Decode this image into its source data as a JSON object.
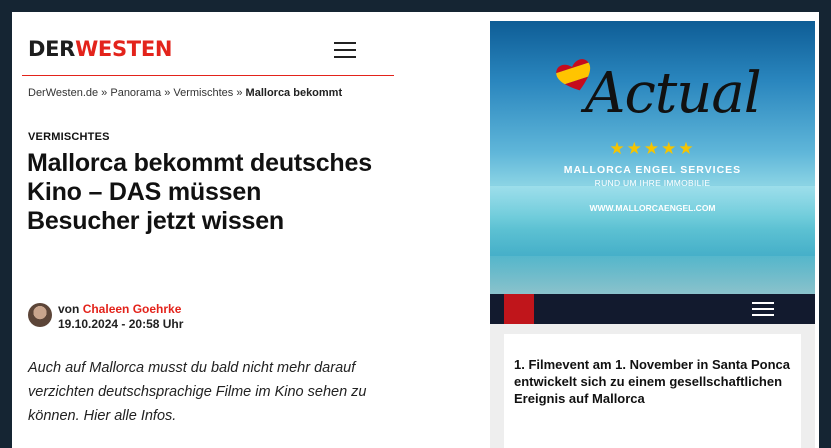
{
  "article": {
    "logo_part1": "DER",
    "logo_part2": "WESTEN",
    "breadcrumb": {
      "items": [
        "DerWesten.de",
        "Panorama",
        "Vermischtes"
      ],
      "current": "Mallorca bekommt",
      "separator": "»"
    },
    "category": "VERMISCHTES",
    "title": "Mallorca bekommt deutsches Kino – DAS müssen Besucher jetzt wissen",
    "byline_prefix": "von",
    "author": "Chaleen Goehrke",
    "date": "19.10.2024 - 20:58 Uhr",
    "teaser": "Auch auf Mallorca musst du bald nicht mehr darauf verzichten deutschsprachige Filme im Kino sehen zu können. Hier alle Infos."
  },
  "ad": {
    "script_title": "Actual",
    "stars": "★★★★★",
    "company": "MALLORCA ENGEL SERVICES",
    "tagline": "RUND UM IHRE IMMOBILIE",
    "url": "WWW.MALLORCAENGEL.COM"
  },
  "side_article": {
    "title": "1. Filmevent am 1. November in Santa Ponca entwickelt sich zu einem gesellschaftlichen Ereignis auf Mallorca"
  },
  "colors": {
    "brand_red": "#e3231b",
    "outer_border": "#152533",
    "nav_dark": "#121a2e",
    "nav_red": "#c0151b",
    "star_gold": "#f5c400"
  },
  "icons": [
    "hamburger-menu-icon",
    "hamburger-menu-icon-white",
    "spain-flag-heart-icon"
  ]
}
